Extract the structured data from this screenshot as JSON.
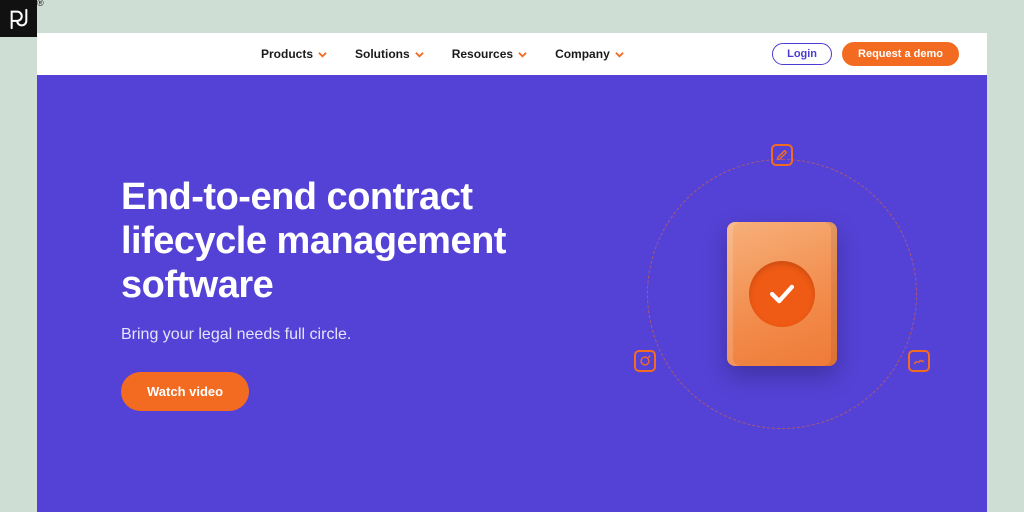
{
  "brand": {
    "logo_letters": "pd",
    "registered": "®"
  },
  "nav": {
    "items": [
      {
        "label": "Products"
      },
      {
        "label": "Solutions"
      },
      {
        "label": "Resources"
      },
      {
        "label": "Company"
      }
    ],
    "login": "Login",
    "demo": "Request a demo"
  },
  "hero": {
    "title": "End-to-end contract lifecycle management software",
    "subtitle": "Bring your legal needs full circle.",
    "cta": "Watch video"
  },
  "colors": {
    "accent_orange": "#f36b21",
    "primary_purple": "#5442d6"
  }
}
